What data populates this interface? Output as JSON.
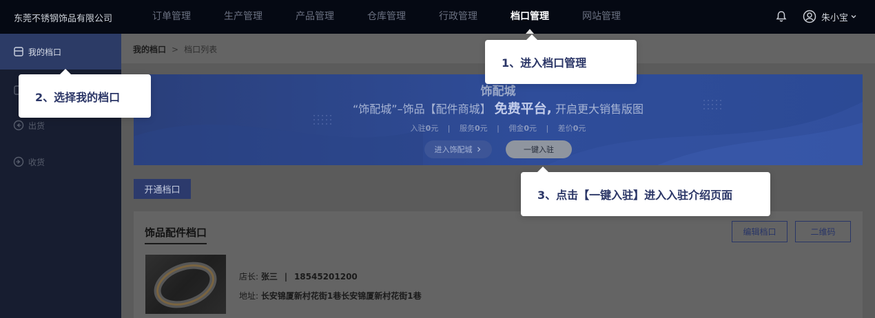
{
  "header": {
    "company": "东莞不锈钢饰品有限公司",
    "nav": [
      "订单管理",
      "生产管理",
      "产品管理",
      "仓库管理",
      "行政管理",
      "档口管理",
      "网站管理"
    ],
    "active_nav": "档口管理",
    "user_name": "朱小宝"
  },
  "sidebar": {
    "items": [
      {
        "label": "我的档口",
        "icon": "store-icon",
        "active": true
      },
      {
        "label": "",
        "icon": "bracket-icon"
      },
      {
        "label": "出货",
        "icon": "shipment-out-icon"
      },
      {
        "label": "收货",
        "icon": "receive-in-icon"
      }
    ]
  },
  "breadcrumb": {
    "current": "我的档口",
    "separator": ">",
    "sub": "档口列表"
  },
  "banner": {
    "logo": "饰配城",
    "slogan_main": "“饰配城”–饰品【配件商城】",
    "slogan_free": "免费平台,",
    "slogan_tail": "开启更大销售版图",
    "stats": [
      {
        "label": "入驻",
        "value": "0",
        "unit": "元"
      },
      {
        "label": "服务",
        "value": "0",
        "unit": "元"
      },
      {
        "label": "佣金",
        "value": "0",
        "unit": "元"
      },
      {
        "label": "差价",
        "value": "0",
        "unit": "元"
      }
    ],
    "enter_btn": "进入饰配城",
    "join_btn": "一键入驻"
  },
  "open_btn": "开通档口",
  "card": {
    "title": "饰品配件档口",
    "edit_btn": "编辑档口",
    "qr_btn": "二维码",
    "owner_label": "店长:",
    "owner_name": "张三",
    "owner_sep": "|",
    "phone": "18545201200",
    "address_label": "地址:",
    "address": "长安锦厦新村花街1巷长安锦厦新村花街1巷"
  },
  "callouts": {
    "step1": "1、进入档口管理",
    "step2": "2、选择我的档口",
    "step3": "3、点击【一键入驻】进入入驻介绍页面"
  },
  "colors": {
    "accent": "#2c3b66",
    "callout_text": "#2a3566",
    "topbar": "#050913"
  }
}
